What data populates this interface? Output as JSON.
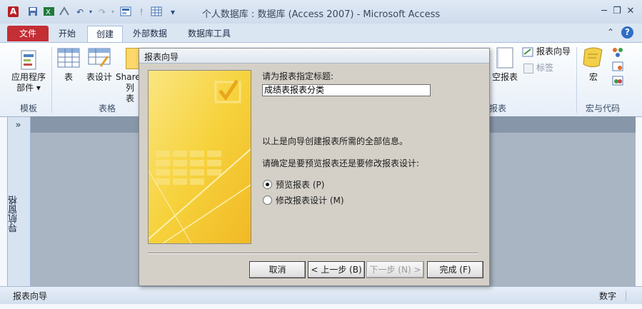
{
  "window": {
    "title": "个人数据库 : 数据库 (Access 2007)  -  Microsoft Access",
    "app_icon_letter": "A",
    "quick_access": [
      "save-icon",
      "excel-icon",
      "sort-icon",
      "undo-icon",
      "redo-icon",
      "form-icon",
      "info-icon",
      "table-icon"
    ],
    "controls": {
      "minimize": "─",
      "restore": "❐",
      "close": "✕"
    },
    "ribbon_controls": {
      "collapse": "⌃",
      "help": "?"
    }
  },
  "tabs": [
    "文件",
    "开始",
    "创建",
    "外部数据",
    "数据库工具"
  ],
  "ribbon": {
    "templates": {
      "label": "模板",
      "app_parts": "应用程序",
      "app_parts_2": "部件 ▾"
    },
    "tables": {
      "label": "表格",
      "table": "表",
      "table_design": "表设计",
      "sharepoint": "Share",
      "sharepoint_2": "列表"
    },
    "reports": {
      "label": "报表",
      "report_wizard": "报表向导",
      "labels": "标签",
      "blank_report": "空报表"
    },
    "macros": {
      "label": "宏与代码",
      "macro": "宏"
    }
  },
  "nav_pane": {
    "toggle": "»",
    "title": "导航窗格"
  },
  "statusbar": {
    "left": "报表向导",
    "right": "数字"
  },
  "dialog": {
    "title": "报表向导",
    "prompt": "请为报表指定标题:",
    "title_value": "成绩表报表分类",
    "info": "以上是向导创建报表所需的全部信息。",
    "question": "请确定是要预览报表还是要修改报表设计:",
    "options": [
      {
        "label": "预览报表 (P)",
        "selected": true
      },
      {
        "label": "修改报表设计 (M)",
        "selected": false
      }
    ],
    "buttons": {
      "cancel": "取消",
      "back": "< 上一步 (B)",
      "next": "下一步 (N) >",
      "finish": "完成 (F)"
    }
  },
  "colors": {
    "file_tab": "#c42e35",
    "banner_yellow": "#f7d13a",
    "banner_light": "#fbe78a",
    "dialog_bg": "#d4d0c8"
  }
}
